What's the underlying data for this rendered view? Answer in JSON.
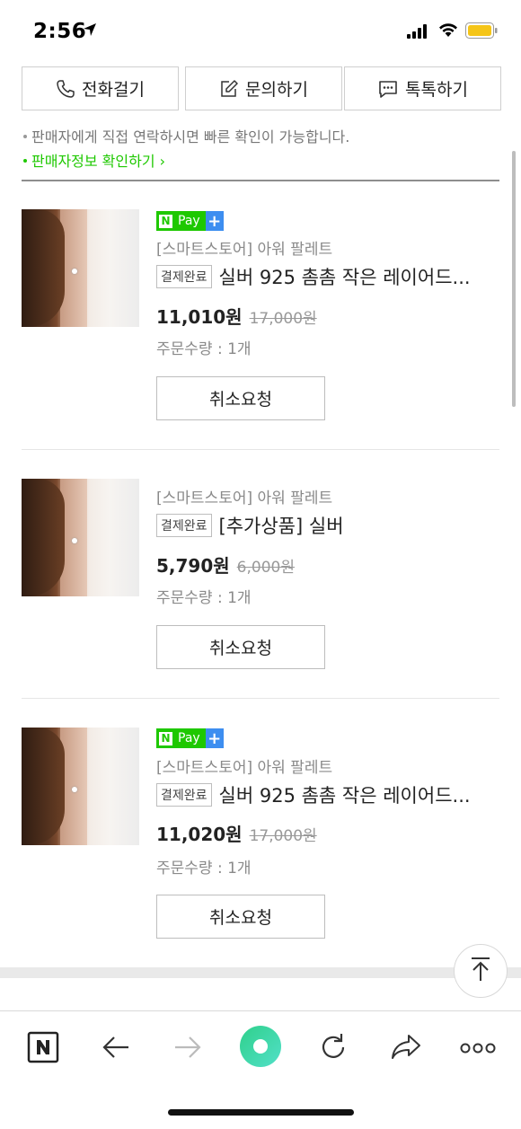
{
  "status_bar": {
    "time": "2:56"
  },
  "contact_actions": [
    {
      "label": "전화걸기",
      "icon": "phone-icon"
    },
    {
      "label": "문의하기",
      "icon": "edit-icon"
    },
    {
      "label": "톡톡하기",
      "icon": "chat-icon"
    }
  ],
  "notice": {
    "text": "판매자에게 직접 연락하시면 빠른 확인이 가능합니다.",
    "link": "판매자정보 확인하기"
  },
  "orders": [
    {
      "npay_label": "Pay",
      "store": "[스마트스토어] 아워 팔레트",
      "status": "결제완료",
      "name": "실버 925 촘촘 작은 레이어드...",
      "price": "11,010원",
      "original_price": "17,000원",
      "quantity": "주문수량 : 1개",
      "cancel_label": "취소요청"
    },
    {
      "npay_label": "",
      "store": "[스마트스토어] 아워 팔레트",
      "status": "결제완료",
      "name": "[추가상품] 실버",
      "price": "5,790원",
      "original_price": "6,000원",
      "quantity": "주문수량 : 1개",
      "cancel_label": "취소요청"
    },
    {
      "npay_label": "Pay",
      "store": "[스마트스토어] 아워 팔레트",
      "status": "결제완료",
      "name": "실버 925 촘촘 작은 레이어드...",
      "price": "11,020원",
      "original_price": "17,000원",
      "quantity": "주문수량 : 1개",
      "cancel_label": "취소요청"
    }
  ],
  "colors": {
    "naver_green": "#1ec800",
    "npay_plus_blue": "#3d8ef0",
    "home_button_gradient": [
      "#2fd08b",
      "#52e0c8"
    ]
  },
  "toolbar_icons": [
    "naver-home-icon",
    "back-arrow-icon",
    "forward-arrow-icon",
    "home-circle-icon",
    "refresh-icon",
    "share-icon",
    "more-icon"
  ]
}
